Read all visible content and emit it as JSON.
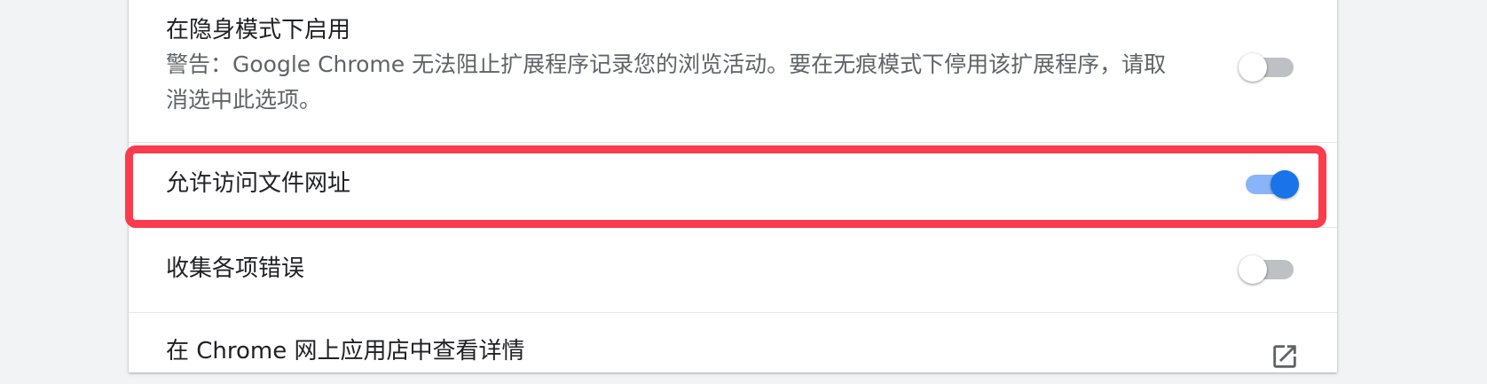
{
  "settings": {
    "incognito": {
      "label": "在隐身模式下启用",
      "desc_line1": "警告：Google Chrome 无法阻止扩展程序记录您的浏览活动。要在无痕模式下停用该扩展程序，请取",
      "desc_line2": "消选中此选项。",
      "enabled": false
    },
    "file_urls": {
      "label": "允许访问文件网址",
      "enabled": true
    },
    "collect_errors": {
      "label": "收集各项错误",
      "enabled": false
    },
    "webstore": {
      "label": "在 Chrome 网上应用店中查看详情"
    }
  },
  "colors": {
    "toggle_on": "#1a73e8",
    "toggle_on_track": "#8ab4f8",
    "toggle_off_track": "#bdc1c6",
    "highlight": "#fa3c4c"
  }
}
